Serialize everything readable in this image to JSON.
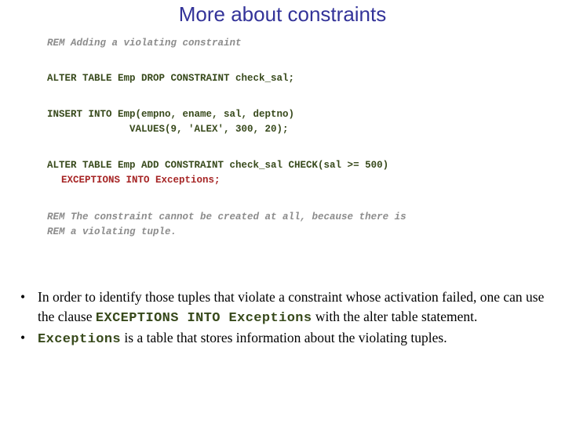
{
  "slide": {
    "title": "More about constraints",
    "title_color": "#333399",
    "background_color": "#ffffff"
  },
  "code_block": {
    "comment_color": "#8c8c8c",
    "sql_color": "#37491b",
    "error_color": "#a62525",
    "lines": [
      {
        "kind": "rem",
        "text": "REM Adding a violating constraint"
      },
      {
        "kind": "sql",
        "text": "ALTER TABLE Emp DROP CONSTRAINT check_sal;"
      },
      {
        "kind": "sql",
        "text": "INSERT INTO Emp(empno, ename, sal, deptno)"
      },
      {
        "kind": "sql",
        "text": "VALUES(9, 'ALEX', 300, 20);"
      },
      {
        "kind": "sql",
        "text": "ALTER TABLE Emp ADD CONSTRAINT check_sal CHECK(sal >= 500)"
      },
      {
        "kind": "err",
        "text": "EXCEPTIONS INTO Exceptions;"
      },
      {
        "kind": "rem",
        "text": "REM The constraint cannot be created at all, because there is"
      },
      {
        "kind": "rem",
        "text": "REM a violating tuple."
      }
    ]
  },
  "bullets": {
    "marker": "•",
    "items": [
      {
        "part1": "In order to identify those tuples that violate a constraint whose activation failed, one can use the clause ",
        "code": "EXCEPTIONS INTO Exceptions",
        "part2": " with the alter table statement."
      },
      {
        "part1": "",
        "code": "Exceptions",
        "part2": " is a table that stores information about the violating tuples."
      }
    ]
  }
}
